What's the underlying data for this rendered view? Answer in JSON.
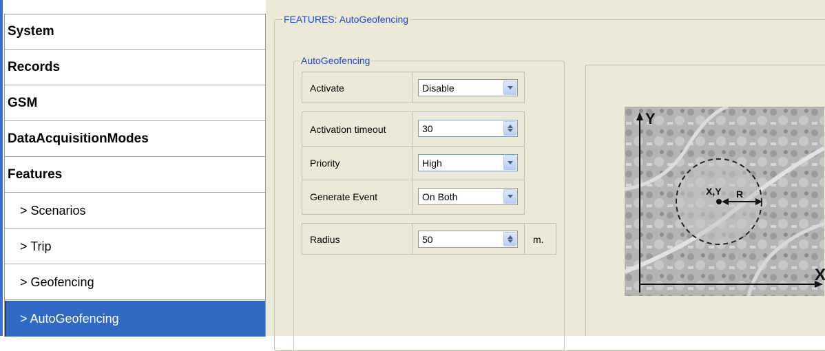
{
  "sidebar": {
    "items": [
      {
        "label": "System"
      },
      {
        "label": "Records"
      },
      {
        "label": "GSM"
      },
      {
        "label": "DataAcquisitionModes"
      },
      {
        "label": "Features"
      },
      {
        "label": "> Scenarios"
      },
      {
        "label": "> Trip"
      },
      {
        "label": "> Geofencing"
      },
      {
        "label": "> AutoGeofencing"
      }
    ],
    "selected": "> AutoGeofencing"
  },
  "main": {
    "group_title": "FEATURES: AutoGeofencing",
    "inner_group_title": "AutoGeofencing",
    "fields": {
      "activate": {
        "label": "Activate",
        "value": "Disable"
      },
      "activation_timeout": {
        "label": "Activation timeout",
        "value": "30"
      },
      "priority": {
        "label": "Priority",
        "value": "High"
      },
      "generate_event": {
        "label": "Generate Event",
        "value": "On Both"
      },
      "radius": {
        "label": "Radius",
        "value": "50",
        "unit": "m."
      }
    }
  },
  "diagram": {
    "y_axis": "Y",
    "x_axis": "X",
    "center": "X,Y",
    "radius": "R"
  },
  "colors": {
    "selection": "#316ac5",
    "group_title": "#1f48c2",
    "panel_bg": "#ece9d8"
  }
}
